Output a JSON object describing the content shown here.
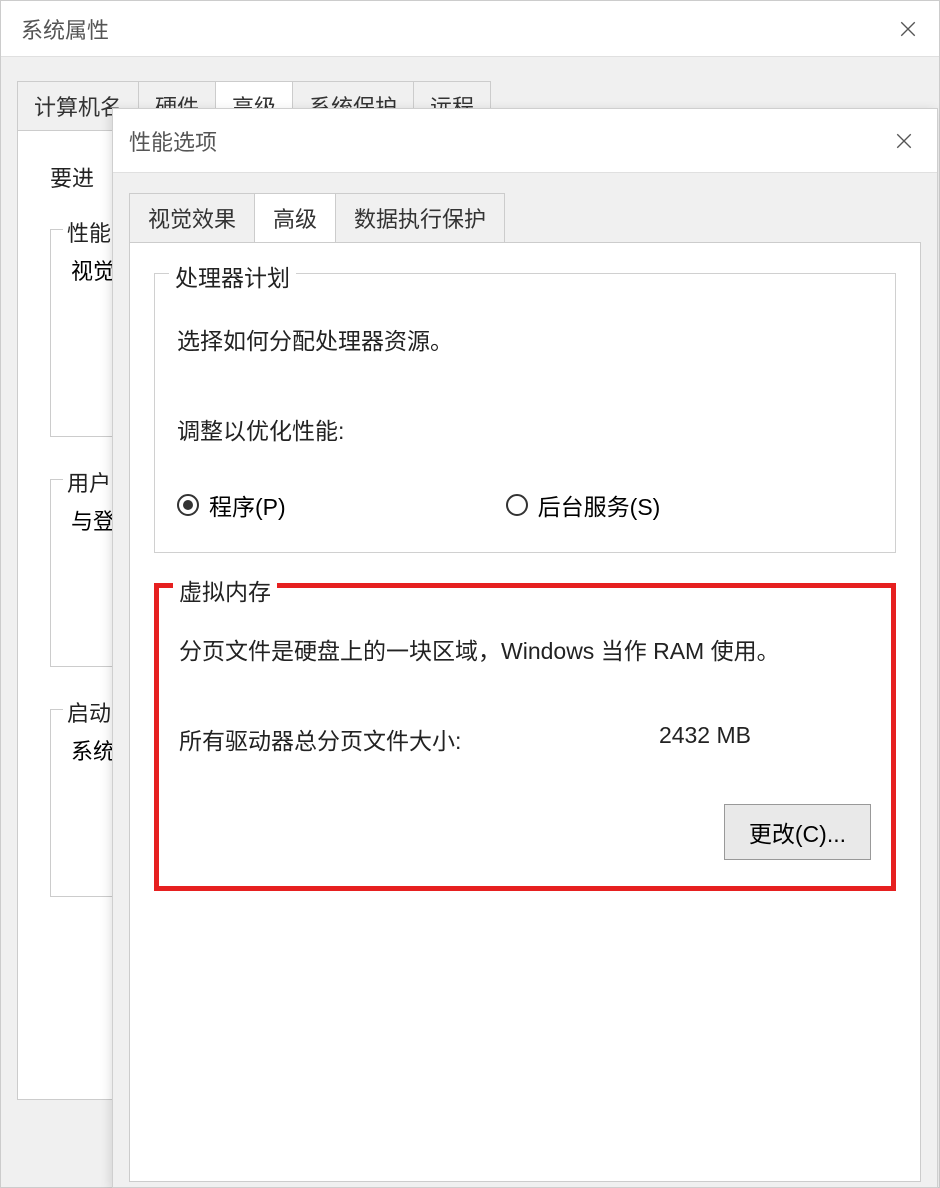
{
  "bg_window": {
    "title": "系统属性",
    "tabs": [
      "计算机名",
      "硬件",
      "高级",
      "系统保护",
      "远程"
    ],
    "active_tab": "高级",
    "body_text": "要进",
    "sections": {
      "perf": {
        "legend": "性能",
        "line": "视觉"
      },
      "user": {
        "legend": "用户",
        "line": "与登"
      },
      "startup": {
        "legend": "启动",
        "line": "系统"
      }
    }
  },
  "fg_window": {
    "title": "性能选项",
    "tabs": [
      "视觉效果",
      "高级",
      "数据执行保护"
    ],
    "active_tab": "高级",
    "processor": {
      "legend": "处理器计划",
      "desc": "选择如何分配处理器资源。",
      "optimize_label": "调整以优化性能:",
      "radio_programs": "程序(P)",
      "radio_services": "后台服务(S)",
      "selected": "programs"
    },
    "virtual_memory": {
      "legend": "虚拟内存",
      "desc": "分页文件是硬盘上的一块区域，Windows 当作 RAM 使用。",
      "total_label": "所有驱动器总分页文件大小:",
      "total_value": "2432 MB",
      "change_button": "更改(C)..."
    }
  }
}
